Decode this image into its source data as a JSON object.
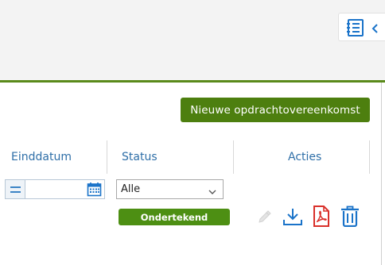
{
  "header": {
    "toc_toggle": {
      "icon": "document-list-icon",
      "chevron": "chevron-left-icon"
    }
  },
  "toolbar": {
    "new_label": "Nieuwe opdrachtovereenkomst"
  },
  "table": {
    "columns": [
      "Einddatum",
      "Status",
      "Acties"
    ],
    "filters": {
      "date_operator_icon": "equals-icon",
      "date_value": "",
      "status_selected": "Alle"
    },
    "rows": [
      {
        "status": "Ondertekend",
        "actions": [
          "edit-icon",
          "download-icon",
          "pdf-icon",
          "trash-icon"
        ]
      }
    ]
  },
  "colors": {
    "accent_green": "#4d7f0f",
    "link_blue": "#2f6fa8",
    "icon_blue": "#1a73c9",
    "pdf_red": "#d9302a"
  }
}
